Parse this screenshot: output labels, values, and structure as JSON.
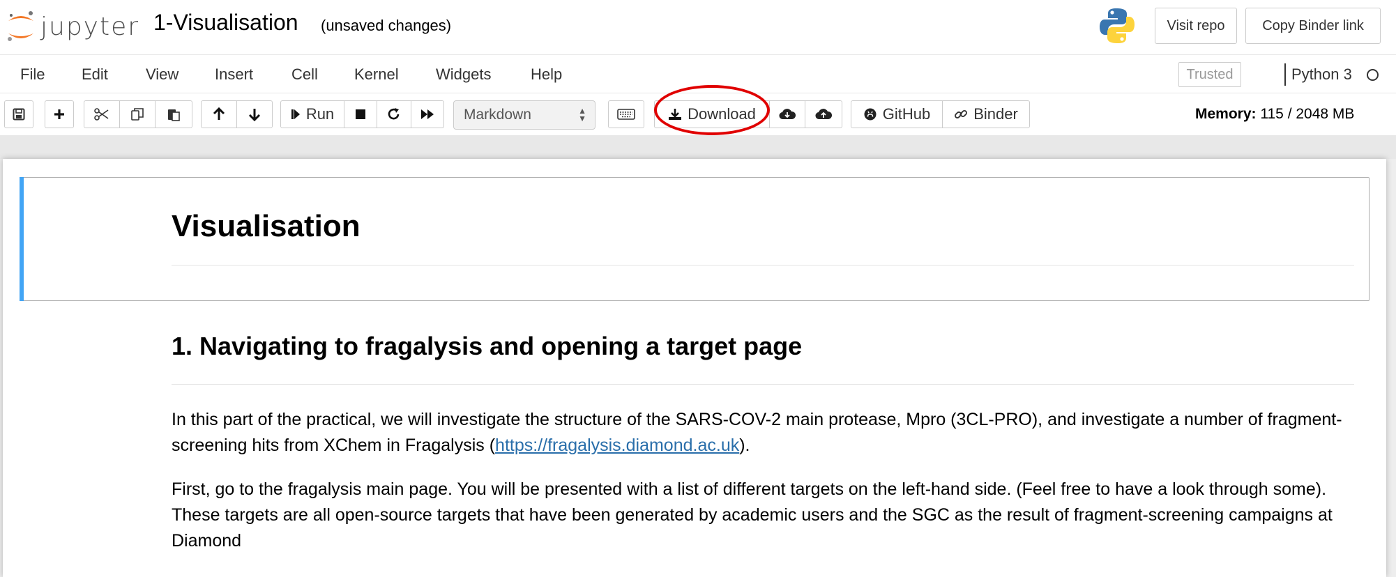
{
  "header": {
    "logo_text": "jupyter",
    "notebook_title": "1-Visualisation",
    "save_status": "(unsaved changes)",
    "visit_repo": "Visit repo",
    "copy_binder": "Copy Binder link"
  },
  "menu": {
    "items": [
      "File",
      "Edit",
      "View",
      "Insert",
      "Cell",
      "Kernel",
      "Widgets",
      "Help"
    ],
    "trusted": "Trusted",
    "kernel": "Python 3"
  },
  "toolbar": {
    "run": "Run",
    "cell_type": "Markdown",
    "download": "Download",
    "github": "GitHub",
    "binder": "Binder",
    "memory_label": "Memory:",
    "memory_value": "115 / 2048 MB"
  },
  "content": {
    "h1": "Visualisation",
    "h2": "1. Navigating to fragalysis and opening a target page",
    "p1_text": "In this part of the practical, we will investigate the structure of the SARS-COV-2 main protease, Mpro (3CL-PRO), and investigate a number of fragment-screening hits from XChem in Fragalysis (",
    "p1_link": "https://fragalysis.diamond.ac.uk",
    "p1_end": ").",
    "p2": "First, go to the fragalysis main page. You will be presented with a list of different targets on the left-hand side. (Feel free to have a look through some). These targets are all open-source targets that have been generated by academic users and the SGC as the result of fragment-screening campaigns at Diamond"
  },
  "colors": {
    "accent_blue": "#42a5f5",
    "highlight_red": "#e00000",
    "jupyter_orange": "#f37726",
    "link": "#296eaa"
  }
}
